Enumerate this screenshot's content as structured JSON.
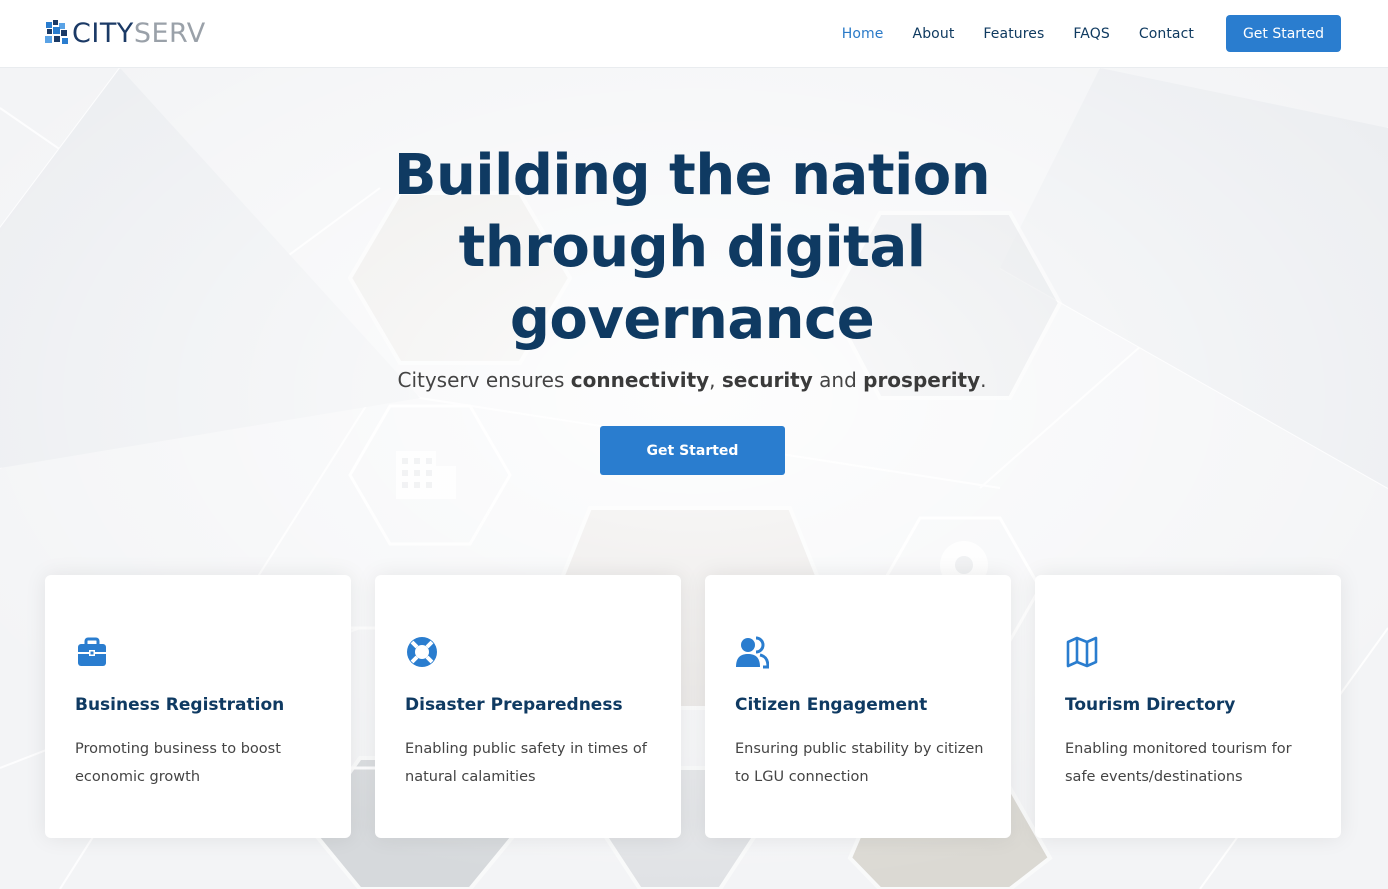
{
  "brand": {
    "name_part1": "CITY",
    "name_part2": "SERV",
    "primary_color": "#2a7dcf",
    "dark_color": "#0f3a62"
  },
  "nav": {
    "items": [
      {
        "label": "Home",
        "active": true
      },
      {
        "label": "About"
      },
      {
        "label": "Features"
      },
      {
        "label": "FAQS"
      },
      {
        "label": "Contact"
      }
    ],
    "cta_label": "Get Started"
  },
  "hero": {
    "title_line1": "Building the nation",
    "title_line2": "through digital",
    "title_line3": "governance",
    "subtitle_prefix": "Cityserv ensures ",
    "subtitle_bold1": "connectivity",
    "subtitle_sep1": ", ",
    "subtitle_bold2": "security",
    "subtitle_sep2": " and ",
    "subtitle_bold3": "prosperity",
    "subtitle_end": ".",
    "cta_label": "Get Started"
  },
  "features": [
    {
      "icon": "briefcase-icon",
      "title": "Business Registration",
      "desc_line1": "Promoting business to boost",
      "desc_line2": "economic growth"
    },
    {
      "icon": "life-ring-icon",
      "title": "Disaster Preparedness",
      "desc_line1": "Enabling public safety in times of",
      "desc_line2": "natural calamities"
    },
    {
      "icon": "people-icon",
      "title": "Citizen Engagement",
      "desc_line1": "Ensuring public stability by citizen",
      "desc_line2": "to LGU connection"
    },
    {
      "icon": "map-icon",
      "title": "Tourism Directory",
      "desc_line1": "Enabling monitored tourism for",
      "desc_line2": "safe events/destinations"
    }
  ]
}
